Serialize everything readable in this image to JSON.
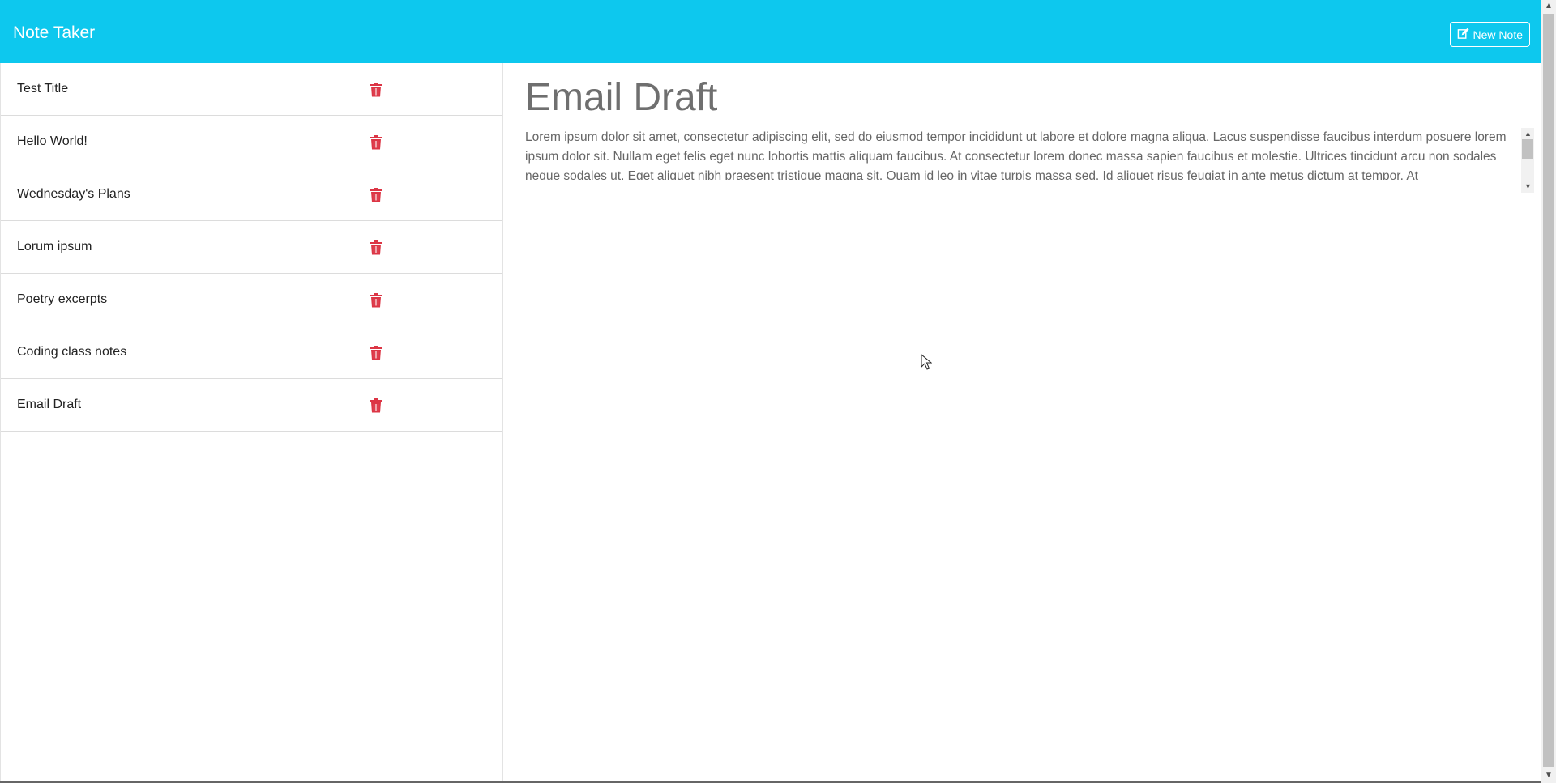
{
  "app": {
    "brand": "Note Taker",
    "new_note_label": "New Note",
    "accent_color": "#0dc8ee",
    "delete_color": "#dc3545"
  },
  "sidebar": {
    "notes": [
      {
        "title": "Test Title",
        "icon": "trash-icon"
      },
      {
        "title": "Hello World!",
        "icon": "trash-icon"
      },
      {
        "title": "Wednesday's Plans",
        "icon": "trash-icon"
      },
      {
        "title": "Lorum ipsum",
        "icon": "trash-icon"
      },
      {
        "title": "Poetry excerpts",
        "icon": "trash-icon"
      },
      {
        "title": "Coding class notes",
        "icon": "trash-icon"
      },
      {
        "title": "Email Draft",
        "icon": "trash-icon"
      }
    ]
  },
  "main": {
    "title": "Email Draft",
    "body": "Lorem ipsum dolor sit amet, consectetur adipiscing elit, sed do eiusmod tempor incididunt ut labore et dolore magna aliqua. Lacus suspendisse faucibus interdum posuere lorem ipsum dolor sit. Nullam eget felis eget nunc lobortis mattis aliquam faucibus. At consectetur lorem donec massa sapien faucibus et molestie. Ultrices tincidunt arcu non sodales neque sodales ut. Eget aliquet nibh praesent tristique magna sit. Quam id leo in vitae turpis massa sed. Id aliquet risus feugiat in ante metus dictum at tempor. At"
  }
}
